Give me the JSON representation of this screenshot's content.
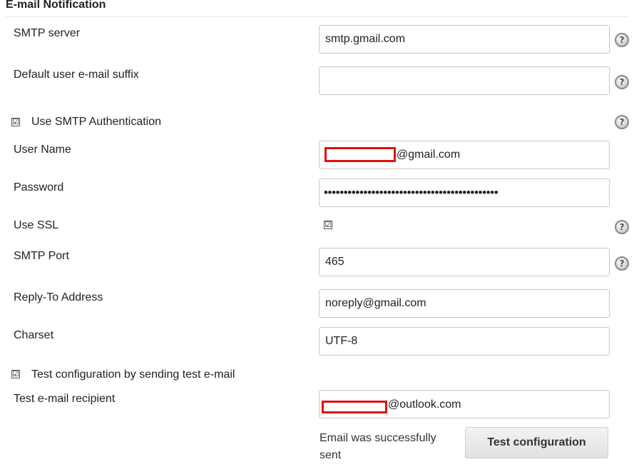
{
  "section": {
    "title": "E-mail Notification"
  },
  "smtp_server": {
    "label": "SMTP server",
    "value": "smtp.gmail.com",
    "help_icon": "question-circle"
  },
  "email_suffix": {
    "label": "Default user e-mail suffix",
    "value": "",
    "help_icon": "question-circle"
  },
  "smtp_auth": {
    "label": "Use SMTP Authentication",
    "checked": true,
    "help_icon": "question-circle"
  },
  "user_name": {
    "label": "User Name",
    "value_suffix": "@gmail.com"
  },
  "password": {
    "label": "Password",
    "value": "••••••••••••••••••••••••••••••••••••••••••••"
  },
  "use_ssl": {
    "label": "Use SSL",
    "checked": true,
    "help_icon": "question-circle"
  },
  "smtp_port": {
    "label": "SMTP Port",
    "value": "465",
    "help_icon": "question-circle"
  },
  "reply_to": {
    "label": "Reply-To Address",
    "value": "noreply@gmail.com"
  },
  "charset": {
    "label": "Charset",
    "value": "UTF-8"
  },
  "test_config": {
    "label": "Test configuration by sending test e-mail",
    "checked": true
  },
  "test_recipient": {
    "label": "Test e-mail recipient",
    "value_suffix": "@outlook.com"
  },
  "status_message": "Email was successfully sent",
  "test_button": {
    "label": "Test configuration"
  },
  "colors": {
    "redaction": "#e01010",
    "button_bg": "#e6e6e6"
  },
  "checkbox_glyph": "☑",
  "help_glyph": "?"
}
